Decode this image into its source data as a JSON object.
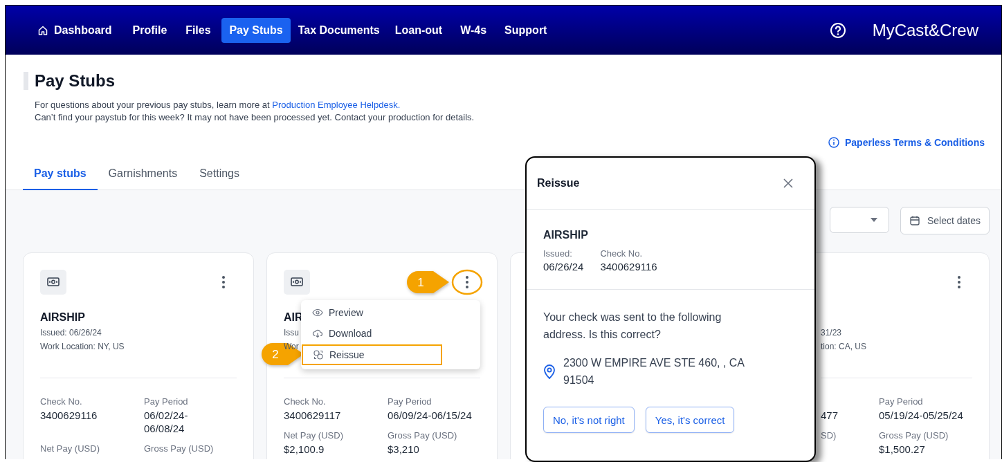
{
  "nav": {
    "items": [
      {
        "label": "Dashboard",
        "selected": false
      },
      {
        "label": "Profile",
        "selected": false
      },
      {
        "label": "Files",
        "selected": false
      },
      {
        "label": "Pay Stubs",
        "selected": true
      },
      {
        "label": "Tax Documents",
        "selected": false
      },
      {
        "label": "Loan-out",
        "selected": false
      },
      {
        "label": "W-4s",
        "selected": false
      },
      {
        "label": "Support",
        "selected": false
      }
    ],
    "brand": "MyCast&Crew"
  },
  "page": {
    "title": "Pay Stubs",
    "info": "For questions about your previous pay stubs, learn more at",
    "info_link": "Production Employee Helpdesk.",
    "note": "Can’t find your paystub for this week? It may not have been processed yet. Contact your production for details.",
    "terms_link": "Paperless Terms & Conditions"
  },
  "tabs": [
    {
      "label": "Pay stubs",
      "selected": true
    },
    {
      "label": "Garnishments",
      "selected": false
    },
    {
      "label": "Settings",
      "selected": false
    }
  ],
  "filters": {
    "date_button": "Select dates"
  },
  "cards": [
    {
      "kind": "full",
      "company": "AIRSHIP",
      "issued": "Issued: 06/26/24",
      "location": "Work Location: NY, US",
      "fields": [
        {
          "label": "Check No.",
          "value": [
            "3400629116"
          ]
        },
        {
          "label": "Pay Period",
          "value": [
            "06/02/24-",
            "06/08/24"
          ]
        },
        {
          "label": "Net Pay (USD)"
        },
        {
          "label": "Gross Pay (USD)"
        }
      ]
    },
    {
      "kind": "menu",
      "company": "AIR",
      "issued": "Issu",
      "location": "Wor",
      "fields": [
        {
          "label": "Check No.",
          "value": [
            "3400629117"
          ]
        },
        {
          "label": "Pay Period",
          "value": [
            "06/09/24-06/15/24"
          ]
        },
        {
          "label": "Net Pay (USD)",
          "value": [
            "$2,100.9"
          ]
        },
        {
          "label": "Gross Pay (USD)",
          "value": [
            "$3,210"
          ]
        }
      ]
    },
    {
      "kind": "partial",
      "issued": "31/23",
      "location": "tion: CA, US",
      "fields": [
        {
          "value": [
            "477"
          ]
        },
        {
          "label": "SD)"
        },
        {
          "label": "Pay Period",
          "value": [
            "05/19/24-05/25/24"
          ]
        },
        {
          "label": "Gross Pay (USD)",
          "value": [
            "$1,500.27"
          ]
        }
      ]
    }
  ],
  "menu": {
    "items": [
      {
        "label": "Preview",
        "highlighted": false
      },
      {
        "label": "Download",
        "highlighted": false
      },
      {
        "label": "Reissue",
        "highlighted": true
      }
    ]
  },
  "callouts": [
    "1",
    "2"
  ],
  "modal": {
    "title": "Reissue",
    "company": "AIRSHIP",
    "details": [
      {
        "label": "Issued:",
        "value": "06/26/24"
      },
      {
        "label": "Check No.",
        "value": "3400629116"
      }
    ],
    "message": "Your check was sent to the following address. Is this correct?",
    "address": "2300 W EMPIRE AVE STE 460, , CA 91504",
    "buttons": [
      "No, it's not right",
      "Yes, it's correct"
    ]
  }
}
